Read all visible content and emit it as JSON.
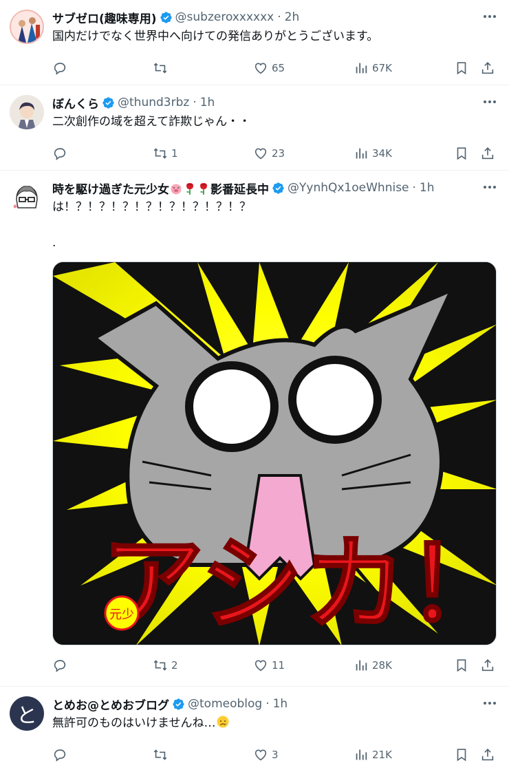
{
  "tweets": [
    {
      "name": "サブゼロ(趣味専用)",
      "handle": "@subzeroxxxxxx",
      "time": "2h",
      "text": "国内だけでなく世界中へ向けての発信ありがとうございます。",
      "replies": "",
      "retweets": "",
      "likes": "65",
      "views": "67K"
    },
    {
      "name": "ぼんくら",
      "handle": "@thund3rbz",
      "time": "1h",
      "text": "二次創作の域を超えて詐欺じゃん・・",
      "replies": "",
      "retweets": "1",
      "likes": "23",
      "views": "34K"
    },
    {
      "name_prefix": "時を駆け過ぎた元少女",
      "name_suffix": "影番延長中",
      "handle": "@YynhQx1oeWhnise",
      "time": "1h",
      "text": "は！？！？！？！？！？！？！？！？",
      "text2": ".",
      "image_caption": "アシカ！",
      "image_stamp": "元少",
      "replies": "",
      "retweets": "2",
      "likes": "11",
      "views": "28K"
    },
    {
      "name": "とめお@とめおブログ",
      "handle": "@tomeoblog",
      "time": "1h",
      "text": "無許可のものはいけませんね…",
      "avatar_glyph": "と",
      "replies": "",
      "retweets": "",
      "likes": "3",
      "views": "21K"
    }
  ],
  "colors": {
    "verified": "#1d9bf0",
    "muted": "#536471",
    "image_bg": "#111111",
    "image_lightning": "#ffff00",
    "image_text": "#e8161b"
  },
  "icons": [
    "more-icon",
    "verified-badge-icon",
    "reply-icon",
    "retweet-icon",
    "like-icon",
    "views-icon",
    "bookmark-icon",
    "share-icon"
  ]
}
